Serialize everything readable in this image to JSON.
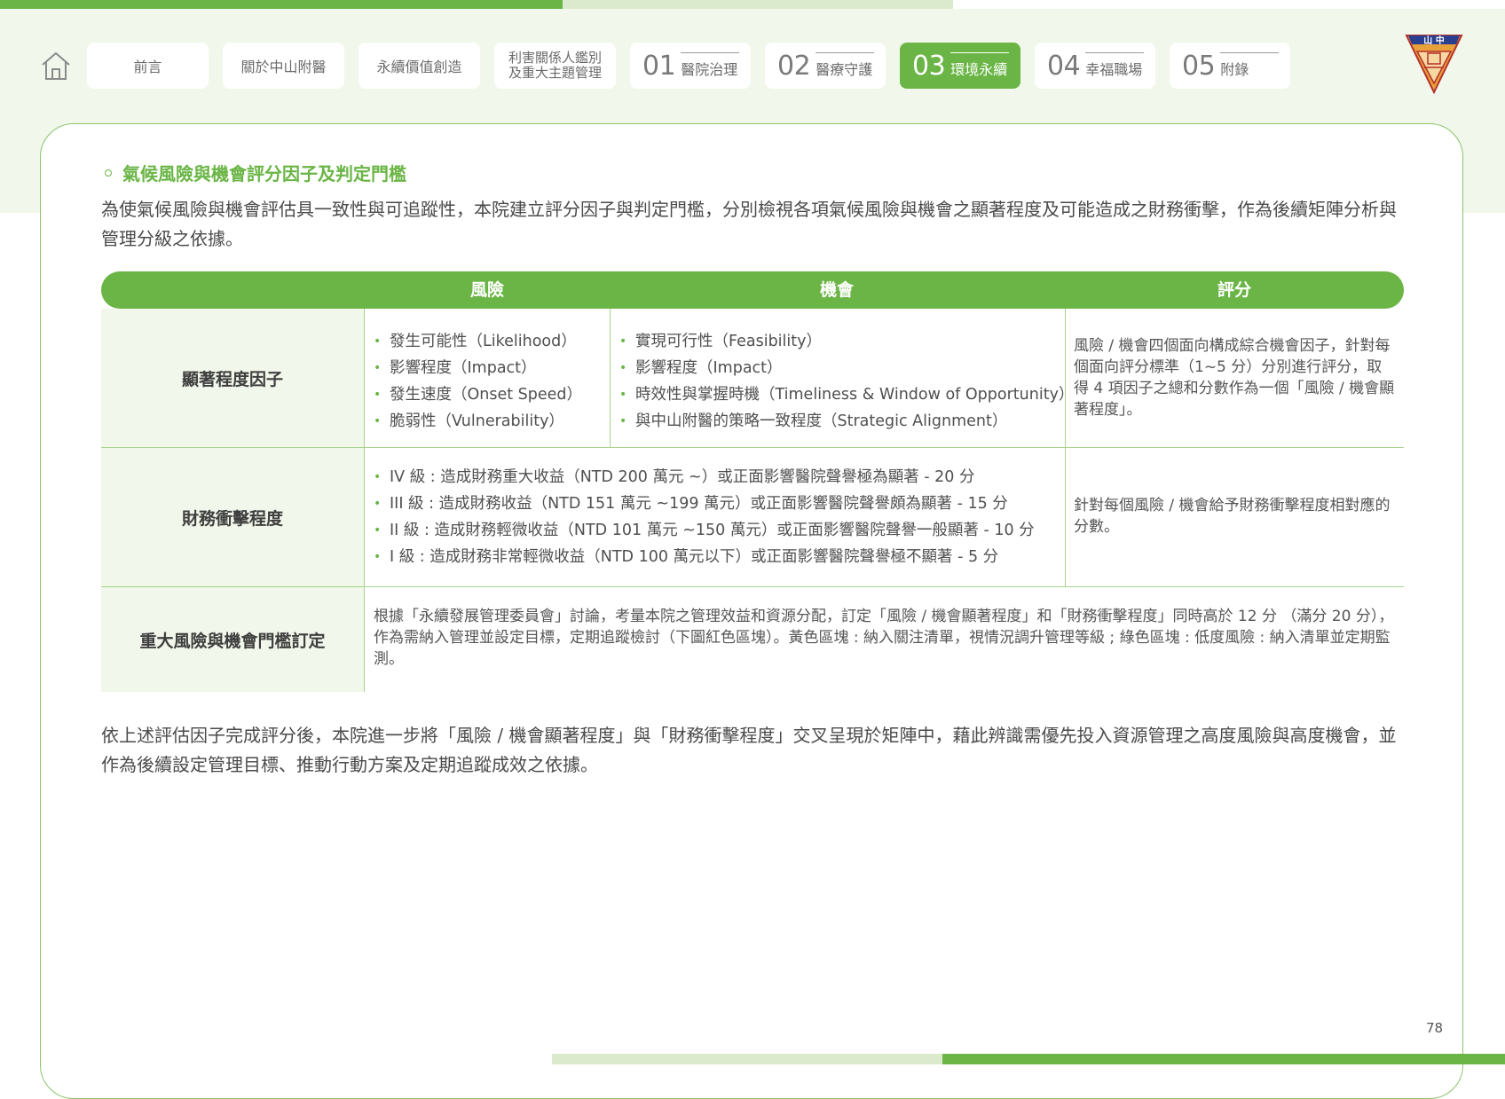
{
  "nav": {
    "tabs": [
      {
        "label": "前言"
      },
      {
        "label": "關於中山附醫"
      },
      {
        "label": "永續價值創造"
      },
      {
        "label_line1": "利害關係人鑑別",
        "label_line2": "及重大主題管理"
      },
      {
        "num": "01",
        "label": "醫院治理"
      },
      {
        "num": "02",
        "label": "醫療守護"
      },
      {
        "num": "03",
        "label": "環境永續"
      },
      {
        "num": "04",
        "label": "幸福職場"
      },
      {
        "num": "05",
        "label": "附錄"
      }
    ]
  },
  "logo": {
    "top_text": "山 中"
  },
  "section": {
    "title": "氣候風險與機會評分因子及判定門檻",
    "intro": "為使氣候風險與機會評估具一致性與可追蹤性，本院建立評分因子與判定門檻，分別檢視各項氣候風險與機會之顯著程度及可能造成之財務衝擊，作為後續矩陣分析與管理分級之依據。",
    "outro": "依上述評估因子完成評分後，本院進一步將「風險 / 機會顯著程度」與「財務衝擊程度」交叉呈現於矩陣中，藉此辨識需優先投入資源管理之高度風險與高度機會，並作為後續設定管理目標、推動行動方案及定期追蹤成效之依據。"
  },
  "table": {
    "headers": {
      "risk": "風險",
      "opportunity": "機會",
      "score": "評分"
    },
    "rows": [
      {
        "label": "顯著程度因子",
        "risk_items": [
          "發生可能性（Likelihood）",
          "影響程度（Impact）",
          "發生速度（Onset Speed）",
          "脆弱性（Vulnerability）"
        ],
        "opp_items": [
          "實現可行性（Feasibility）",
          "影響程度（Impact）",
          "時效性與掌握時機（Timeliness & Window of Opportunity）",
          "與中山附醫的策略一致程度（Strategic Alignment）"
        ],
        "score": "風險 / 機會四個面向構成綜合機會因子，針對每個面向評分標準（1~5 分）分別進行評分，取得 4 項因子之總和分數作為一個「風險 / 機會顯著程度」。"
      },
      {
        "label": "財務衝擊程度",
        "items": [
          "IV 級 : 造成財務重大收益（NTD 200 萬元 ~）或正面影響醫院聲譽極為顯著 - 20 分",
          "III 級 : 造成財務收益（NTD 151 萬元 ~199 萬元）或正面影響醫院聲譽頗為顯著 - 15 分",
          "II 級 : 造成財務輕微收益（NTD 101 萬元 ~150 萬元）或正面影響醫院聲譽一般顯著 - 10 分",
          "I 級 :  造成財務非常輕微收益（NTD 100 萬元以下）或正面影響醫院聲譽極不顯著 - 5 分"
        ],
        "score": "針對每個風險 / 機會給予財務衝擊程度相對應的分數。"
      },
      {
        "label": "重大風險與機會門檻訂定",
        "text": "根據「永續發展管理委員會」討論，考量本院之管理效益和資源分配，訂定「風險 / 機會顯著程度」和「財務衝擊程度」同時高於 12 分 （滿分 20 分），作為需納入管理並設定目標，定期追蹤檢討（下圖紅色區塊）。黃色區塊 : 納入關注清單，視情況調升管理等級 ; 綠色區塊 : 低度風險 : 納入清單並定期監測。"
      }
    ]
  },
  "page_number": "78",
  "colors": {
    "accent": "#6ab545",
    "accent_light": "#dbeacc",
    "header_bg": "#f1f7ea"
  }
}
